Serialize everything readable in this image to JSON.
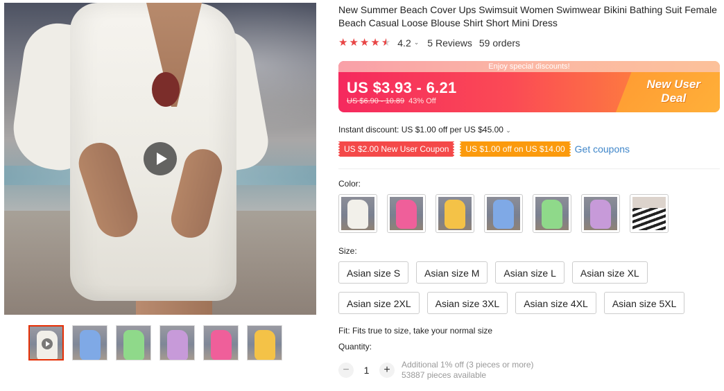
{
  "product": {
    "title": "New Summer Beach Cover Ups Swimsuit Women Swimwear Bikini Bathing Suit Female Beach Casual Loose Blouse Shirt Short Mini Dress",
    "rating": "4.2",
    "rating_stars": 4.5,
    "reviews": "5 Reviews",
    "orders": "59 orders"
  },
  "price": {
    "banner": "Enjoy special discounts!",
    "current": "US $3.93 - 6.21",
    "original": "US $6.90 - 10.89",
    "discount": "43% Off",
    "deal_line1": "New User",
    "deal_line2": "Deal"
  },
  "promotions": {
    "instant_discount": "Instant discount: US $1.00 off per US $45.00",
    "coupon1": "US $2.00 New User Coupon",
    "coupon2": "US $1.00 off on US $14.00",
    "get_coupons": "Get coupons"
  },
  "color": {
    "label": "Color:",
    "options": [
      "white",
      "pink",
      "yellow",
      "blue",
      "green",
      "purple",
      "black-white stripe"
    ],
    "selected": null
  },
  "size": {
    "label": "Size:",
    "row1": [
      "Asian size S",
      "Asian size M",
      "Asian size L",
      "Asian size XL"
    ],
    "row2": [
      "Asian size 2XL",
      "Asian size 3XL",
      "Asian size 4XL",
      "Asian size 5XL"
    ]
  },
  "fit": "Fit: Fits true to size, take your normal size",
  "quantity": {
    "label": "Quantity:",
    "value": "1",
    "minus": "−",
    "plus": "+",
    "additional": "Additional 1% off (3 pieces or more)",
    "available": "53887 pieces available"
  },
  "colors": {
    "accent_red": "#e62e04",
    "coupon_red": "#f44949",
    "coupon_orange": "#fb9a0d",
    "link_blue": "#3f86c9"
  }
}
